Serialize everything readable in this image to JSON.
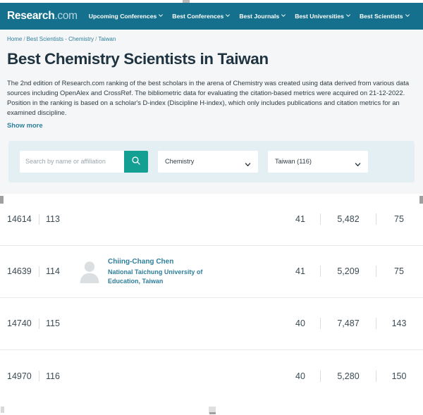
{
  "header": {
    "brand_name": "Research",
    "brand_tld": ".com",
    "nav": [
      {
        "label": "Upcoming Conferences",
        "icon": "chevron-down-icon"
      },
      {
        "label": "Best Conferences",
        "icon": "chevron-down-icon"
      },
      {
        "label": "Best Journals",
        "icon": "chevron-down-icon"
      },
      {
        "label": "Best Universities",
        "icon": "chevron-down-icon"
      },
      {
        "label": "Best Scientists",
        "icon": "chevron-down-icon"
      }
    ]
  },
  "breadcrumb": {
    "home": "Home",
    "section": "Best Scientists - Chemistry",
    "country": "Taiwan",
    "separator": "/"
  },
  "page": {
    "title": "Best Chemistry Scientists in Taiwan",
    "description": "The 2nd edition of Research.com ranking of the best scholars in the arena of Chemistry was created using data derived from various data sources including OpenAlex and CrossRef. The bibliometric data for evaluating the citation-based metrics were acquired on 21-12-2022. Position in the ranking is based on a scholar's D-index (Discipline H-index), which only includes publications and citation metrics for an examined discipline.",
    "show_more_label": "Show more"
  },
  "filters": {
    "search": {
      "placeholder": "Search by name or affiliation",
      "value": "",
      "button_icon": "search-icon"
    },
    "discipline": {
      "selected": "Chemistry",
      "icon": "chevron-down-icon"
    },
    "country": {
      "selected": "Taiwan (116)",
      "icon": "chevron-down-icon"
    }
  },
  "colors": {
    "header_bg": "#14708c",
    "accent_link": "#2e7f9b",
    "search_button": "#13a093",
    "filter_panel_bg": "#e4eff3",
    "page_band_bg": "#f4f6f7"
  },
  "table": {
    "rows": [
      {
        "world_rank": "14614",
        "national_rank": "113",
        "name": "",
        "affiliation": "",
        "d_index": "41",
        "citations": "5,482",
        "publications": "75",
        "has_avatar": false
      },
      {
        "world_rank": "14639",
        "national_rank": "114",
        "name": "Chiing-Chang Chen",
        "affiliation": "National Taichung University of Education, Taiwan",
        "d_index": "41",
        "citations": "5,209",
        "publications": "75",
        "has_avatar": true
      },
      {
        "world_rank": "14740",
        "national_rank": "115",
        "name": "",
        "affiliation": "",
        "d_index": "40",
        "citations": "7,487",
        "publications": "143",
        "has_avatar": false
      },
      {
        "world_rank": "14970",
        "national_rank": "116",
        "name": "",
        "affiliation": "",
        "d_index": "40",
        "citations": "5,280",
        "publications": "150",
        "has_avatar": false
      }
    ]
  }
}
